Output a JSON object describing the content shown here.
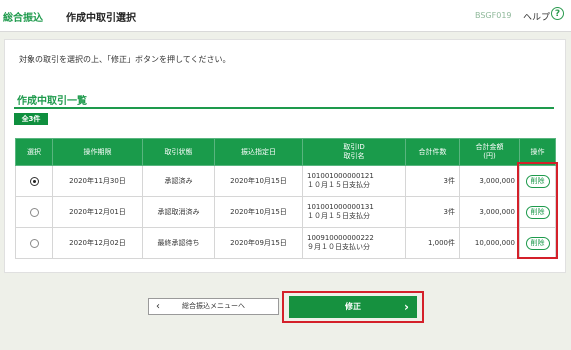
{
  "header": {
    "brand": "総合振込",
    "title": "作成中取引選択",
    "screen_code": "BSGF019",
    "help_label": "ヘルプ",
    "help_icon": "?"
  },
  "instruction": "対象の取引を選択の上、「修正」ボタンを押してください。",
  "section": {
    "title": "作成中取引一覧",
    "count_badge": "全3件"
  },
  "table": {
    "headers": [
      "選択",
      "操作期限",
      "取引状態",
      "振込指定日",
      "取引ID\n取引名",
      "合計件数",
      "合計金額\n(円)",
      "操作"
    ],
    "rows": [
      {
        "selected": true,
        "deadline": "2020年11月30日",
        "status": "承認済み",
        "transfer_date": "2020年10月15日",
        "id": "101001000000121",
        "name": "１０月１５日支払分",
        "count": "3件",
        "amount": "3,000,000",
        "action": "削除"
      },
      {
        "selected": false,
        "deadline": "2020年12月01日",
        "status": "承認取消済み",
        "transfer_date": "2020年10月15日",
        "id": "101001000000131",
        "name": "１０月１５日支払分",
        "count": "3件",
        "amount": "3,000,000",
        "action": "削除"
      },
      {
        "selected": false,
        "deadline": "2020年12月02日",
        "status": "最終承認待ち",
        "transfer_date": "2020年09月15日",
        "id": "100910000000222",
        "name": "９月１０日支払い分",
        "count": "1,000件",
        "amount": "10,000,000",
        "action": "削除"
      }
    ]
  },
  "buttons": {
    "back_label": "総合振込メニューへ",
    "back_icon": "chevron-left-icon",
    "fix_label": "修正",
    "fix_icon": "chevron-right-icon"
  },
  "colors": {
    "accent": "#1a9b4b",
    "highlight": "#d4202a",
    "background": "#eef0e9"
  }
}
